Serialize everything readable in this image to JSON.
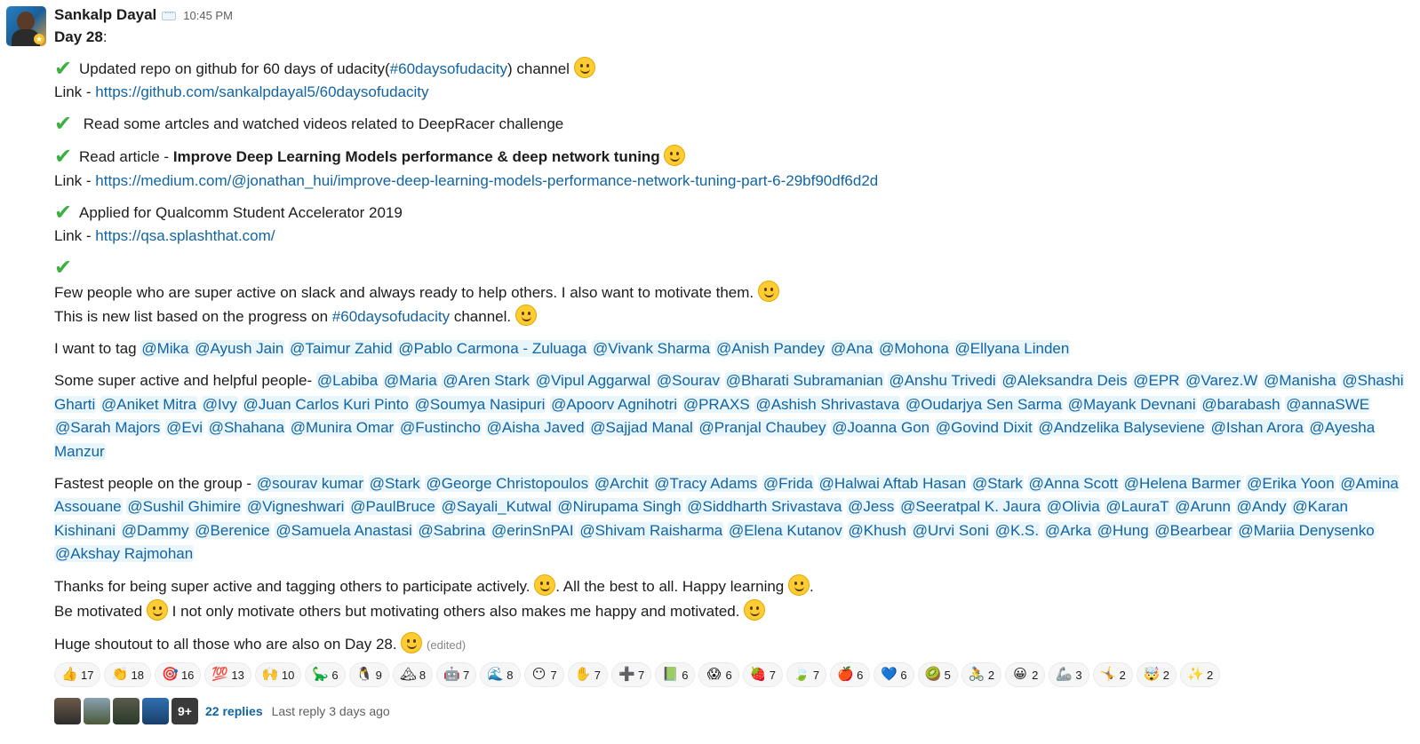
{
  "message": {
    "author": "Sankalp Dayal",
    "time": "10:45 PM",
    "day": "Day 28",
    "item1_text": "Updated repo on github for 60 days of udacity(",
    "item1_channel": "#60daysofudacity",
    "item1_after": ")  channel",
    "link_label": "Link - ",
    "link1": "https://github.com/sankalpdayal5/60daysofudacity",
    "item2_text": " Read some artcles and watched videos related to DeepRacer challenge",
    "item3_prefix": "Read article - ",
    "item3_bold": "Improve Deep Learning Models performance & deep network tuning",
    "link3": "https://medium.com/@jonathan_hui/improve-deep-learning-models-performance-network-tuning-part-6-29bf90df6d2d",
    "item4_text": "Applied for Qualcomm Student Accelerator 2019",
    "link4": "https://qsa.splashthat.com/",
    "few_people": "Few people who are super active on slack and always ready to help others. I also want to motivate them.",
    "new_list_prefix": "This is new list based on the progress on ",
    "new_list_channel": "#60daysofudacity",
    "new_list_suffix": " channel.",
    "tag_prefix": "I want to tag ",
    "tag_mentions": [
      "@Mika",
      "@Ayush Jain",
      "@Taimur Zahid",
      "@Pablo Carmona - Zuluaga",
      "@Vivank Sharma",
      "@Anish Pandey",
      "@Ana",
      "@Mohona",
      "@Ellyana Linden"
    ],
    "active_prefix": "Some super active and helpful people- ",
    "active_mentions": [
      "@Labiba",
      "@Maria",
      "@Aren Stark",
      "@Vipul Aggarwal",
      "@Sourav",
      "@Bharati Subramanian",
      "@Anshu Trivedi",
      "@Aleksandra Deis",
      "@EPR",
      "@Varez.W",
      "@Manisha",
      "@Shashi Gharti",
      "@Aniket Mitra",
      "@Ivy",
      "@Juan Carlos Kuri Pinto",
      "@Soumya Nasipuri",
      "@Apoorv Agnihotri",
      "@PRAXS",
      "@Ashish Shrivastava",
      "@Oudarjya Sen Sarma",
      "@Mayank Devnani",
      "@barabash",
      "@annaSWE",
      "@Sarah Majors",
      "@Evi",
      "@Shahana",
      "@Munira Omar",
      "@Fustincho",
      "@Aisha Javed",
      "@Sajjad Manal",
      "@Pranjal Chaubey",
      "@Joanna Gon",
      "@Govind Dixit",
      "@Andzelika Balyseviene",
      "@Ishan Arora",
      "@Ayesha Manzur"
    ],
    "fastest_prefix": "Fastest people on the group - ",
    "fastest_mentions": [
      "@sourav kumar",
      "@Stark",
      "@George Christopoulos",
      "@Archit",
      "@Tracy Adams",
      "@Frida",
      "@Halwai Aftab Hasan",
      "@Stark",
      "@Anna Scott",
      "@Helena Barmer",
      "@Erika Yoon",
      "@Amina Assouane",
      "@Sushil Ghimire",
      "@Vigneshwari",
      "@PaulBruce",
      "@Sayali_Kutwal",
      "@Nirupama Singh",
      "@Siddharth Srivastava",
      "@Jess",
      "@Seeratpal K. Jaura",
      "@Olivia",
      "@LauraT",
      "@Arunn",
      "@Andy",
      "@Karan Kishinani",
      "@Dammy",
      "@Berenice",
      "@Samuela Anastasi",
      "@Sabrina",
      "@erinSnPAI",
      "@Shivam Raisharma",
      "@Elena Kutanov",
      "@Khush",
      "@Urvi Soni",
      "@K.S.",
      "@Arka",
      "@Hung",
      "@Bearbear",
      "@Mariia Denysenko",
      "@Akshay Rajmohan"
    ],
    "thanks_a": "Thanks for being super active and tagging others to participate actively. ",
    "thanks_b": ". All the best to all. Happy learning ",
    "thanks_c": ".",
    "motivated_a": "Be motivated ",
    "motivated_b": " I not only motivate others but motivating others also makes me happy and motivated. ",
    "shoutout": "Huge shoutout to all those who are also on Day 28. ",
    "edited": "(edited)"
  },
  "reactions": [
    {
      "icon": "👍",
      "count": "17"
    },
    {
      "icon": "👏",
      "count": "18"
    },
    {
      "icon": "🎯",
      "count": "16"
    },
    {
      "icon": "💯",
      "count": "13"
    },
    {
      "icon": "🙌",
      "count": "10"
    },
    {
      "icon": "🦕",
      "count": "6"
    },
    {
      "icon": "🐧",
      "count": "9"
    },
    {
      "icon": "🏔",
      "count": "8"
    },
    {
      "icon": "🤖",
      "count": "7"
    },
    {
      "icon": "🌊",
      "count": "8"
    },
    {
      "icon": "😶",
      "count": "7"
    },
    {
      "icon": "✋",
      "count": "7"
    },
    {
      "icon": "➕",
      "count": "7"
    },
    {
      "icon": "📗",
      "count": "6"
    },
    {
      "icon": "😱",
      "count": "6"
    },
    {
      "icon": "🍓",
      "count": "7"
    },
    {
      "icon": "🍃",
      "count": "7"
    },
    {
      "icon": "🍎",
      "count": "6"
    },
    {
      "icon": "💙",
      "count": "6"
    },
    {
      "icon": "🥝",
      "count": "5"
    },
    {
      "icon": "🚴",
      "count": "2"
    },
    {
      "icon": "😀",
      "count": "2"
    },
    {
      "icon": "🦾",
      "count": "3"
    },
    {
      "icon": "🤸",
      "count": "2"
    },
    {
      "icon": "🤯",
      "count": "2"
    },
    {
      "icon": "✨",
      "count": "2"
    }
  ],
  "thread": {
    "more_badge": "9+",
    "replies": "22 replies",
    "last_reply": "Last reply 3 days ago"
  },
  "colors": {
    "link": "#1264a3",
    "mention_bg": "#e8f5fa",
    "check": "#3cb043"
  }
}
